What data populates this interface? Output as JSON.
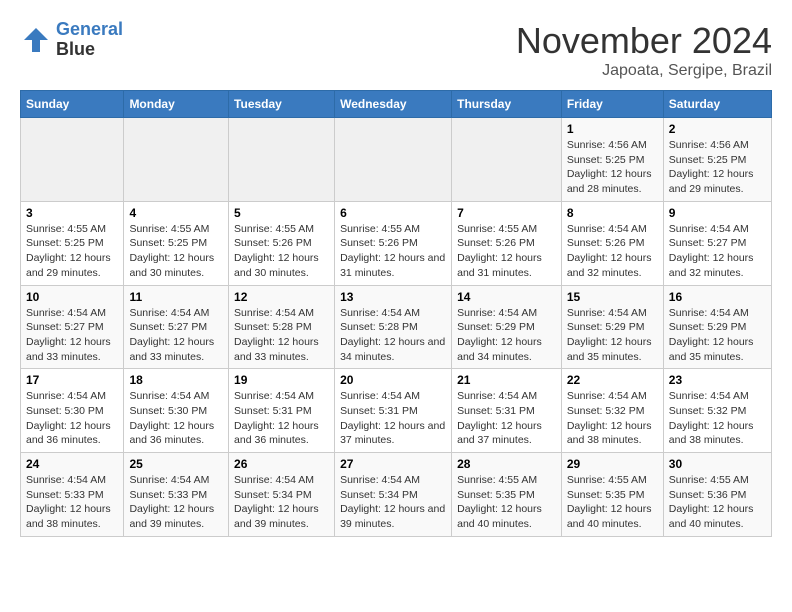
{
  "header": {
    "logo_line1": "General",
    "logo_line2": "Blue",
    "month": "November 2024",
    "location": "Japoata, Sergipe, Brazil"
  },
  "weekdays": [
    "Sunday",
    "Monday",
    "Tuesday",
    "Wednesday",
    "Thursday",
    "Friday",
    "Saturday"
  ],
  "weeks": [
    [
      {
        "day": "",
        "info": ""
      },
      {
        "day": "",
        "info": ""
      },
      {
        "day": "",
        "info": ""
      },
      {
        "day": "",
        "info": ""
      },
      {
        "day": "",
        "info": ""
      },
      {
        "day": "1",
        "info": "Sunrise: 4:56 AM\nSunset: 5:25 PM\nDaylight: 12 hours and 28 minutes."
      },
      {
        "day": "2",
        "info": "Sunrise: 4:56 AM\nSunset: 5:25 PM\nDaylight: 12 hours and 29 minutes."
      }
    ],
    [
      {
        "day": "3",
        "info": "Sunrise: 4:55 AM\nSunset: 5:25 PM\nDaylight: 12 hours and 29 minutes."
      },
      {
        "day": "4",
        "info": "Sunrise: 4:55 AM\nSunset: 5:25 PM\nDaylight: 12 hours and 30 minutes."
      },
      {
        "day": "5",
        "info": "Sunrise: 4:55 AM\nSunset: 5:26 PM\nDaylight: 12 hours and 30 minutes."
      },
      {
        "day": "6",
        "info": "Sunrise: 4:55 AM\nSunset: 5:26 PM\nDaylight: 12 hours and 31 minutes."
      },
      {
        "day": "7",
        "info": "Sunrise: 4:55 AM\nSunset: 5:26 PM\nDaylight: 12 hours and 31 minutes."
      },
      {
        "day": "8",
        "info": "Sunrise: 4:54 AM\nSunset: 5:26 PM\nDaylight: 12 hours and 32 minutes."
      },
      {
        "day": "9",
        "info": "Sunrise: 4:54 AM\nSunset: 5:27 PM\nDaylight: 12 hours and 32 minutes."
      }
    ],
    [
      {
        "day": "10",
        "info": "Sunrise: 4:54 AM\nSunset: 5:27 PM\nDaylight: 12 hours and 33 minutes."
      },
      {
        "day": "11",
        "info": "Sunrise: 4:54 AM\nSunset: 5:27 PM\nDaylight: 12 hours and 33 minutes."
      },
      {
        "day": "12",
        "info": "Sunrise: 4:54 AM\nSunset: 5:28 PM\nDaylight: 12 hours and 33 minutes."
      },
      {
        "day": "13",
        "info": "Sunrise: 4:54 AM\nSunset: 5:28 PM\nDaylight: 12 hours and 34 minutes."
      },
      {
        "day": "14",
        "info": "Sunrise: 4:54 AM\nSunset: 5:29 PM\nDaylight: 12 hours and 34 minutes."
      },
      {
        "day": "15",
        "info": "Sunrise: 4:54 AM\nSunset: 5:29 PM\nDaylight: 12 hours and 35 minutes."
      },
      {
        "day": "16",
        "info": "Sunrise: 4:54 AM\nSunset: 5:29 PM\nDaylight: 12 hours and 35 minutes."
      }
    ],
    [
      {
        "day": "17",
        "info": "Sunrise: 4:54 AM\nSunset: 5:30 PM\nDaylight: 12 hours and 36 minutes."
      },
      {
        "day": "18",
        "info": "Sunrise: 4:54 AM\nSunset: 5:30 PM\nDaylight: 12 hours and 36 minutes."
      },
      {
        "day": "19",
        "info": "Sunrise: 4:54 AM\nSunset: 5:31 PM\nDaylight: 12 hours and 36 minutes."
      },
      {
        "day": "20",
        "info": "Sunrise: 4:54 AM\nSunset: 5:31 PM\nDaylight: 12 hours and 37 minutes."
      },
      {
        "day": "21",
        "info": "Sunrise: 4:54 AM\nSunset: 5:31 PM\nDaylight: 12 hours and 37 minutes."
      },
      {
        "day": "22",
        "info": "Sunrise: 4:54 AM\nSunset: 5:32 PM\nDaylight: 12 hours and 38 minutes."
      },
      {
        "day": "23",
        "info": "Sunrise: 4:54 AM\nSunset: 5:32 PM\nDaylight: 12 hours and 38 minutes."
      }
    ],
    [
      {
        "day": "24",
        "info": "Sunrise: 4:54 AM\nSunset: 5:33 PM\nDaylight: 12 hours and 38 minutes."
      },
      {
        "day": "25",
        "info": "Sunrise: 4:54 AM\nSunset: 5:33 PM\nDaylight: 12 hours and 39 minutes."
      },
      {
        "day": "26",
        "info": "Sunrise: 4:54 AM\nSunset: 5:34 PM\nDaylight: 12 hours and 39 minutes."
      },
      {
        "day": "27",
        "info": "Sunrise: 4:54 AM\nSunset: 5:34 PM\nDaylight: 12 hours and 39 minutes."
      },
      {
        "day": "28",
        "info": "Sunrise: 4:55 AM\nSunset: 5:35 PM\nDaylight: 12 hours and 40 minutes."
      },
      {
        "day": "29",
        "info": "Sunrise: 4:55 AM\nSunset: 5:35 PM\nDaylight: 12 hours and 40 minutes."
      },
      {
        "day": "30",
        "info": "Sunrise: 4:55 AM\nSunset: 5:36 PM\nDaylight: 12 hours and 40 minutes."
      }
    ]
  ]
}
